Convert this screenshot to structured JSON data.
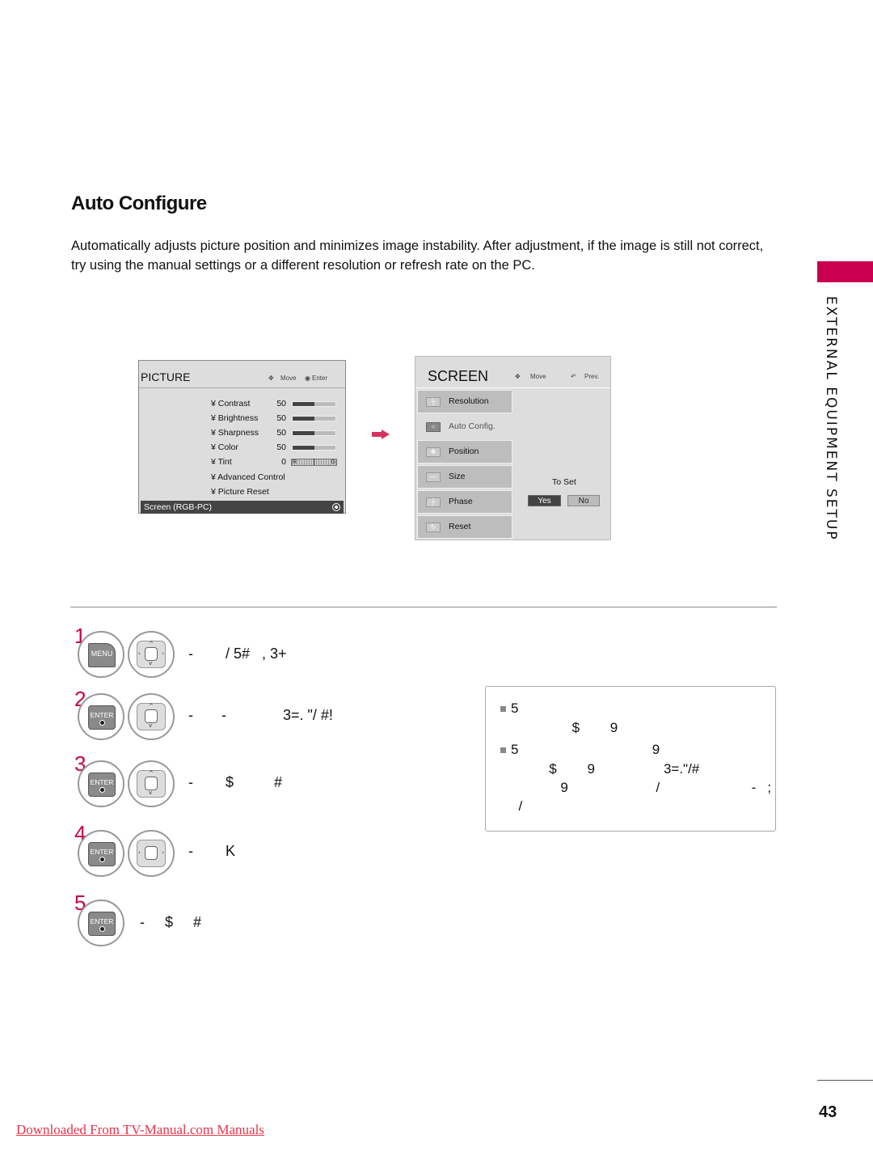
{
  "heading": "Auto Configure",
  "intro": "Automatically adjusts picture position and minimizes image instability. After adjustment, if the image is still not correct, try using the manual settings or a different resolution or refresh rate on the PC.",
  "side": {
    "label": "EXTERNAL EQUIPMENT SETUP",
    "accent_color": "#c8004f"
  },
  "picture_menu": {
    "title": "PICTURE",
    "hint_move": "Move",
    "hint_enter": "Enter",
    "items": [
      {
        "label": "¥ Contrast",
        "value": "50",
        "level_percent": 50
      },
      {
        "label": "¥ Brightness",
        "value": "50",
        "level_percent": 50
      },
      {
        "label": "¥ Sharpness",
        "value": "50",
        "level_percent": 50
      },
      {
        "label": "¥ Color",
        "value": "50",
        "level_percent": 50
      },
      {
        "label": "¥ Tint",
        "value": "0",
        "tint_left": "R",
        "tint_right": "G"
      },
      {
        "label": "¥ Advanced Control"
      },
      {
        "label": "¥ Picture Reset"
      }
    ],
    "selected_item": "Screen (RGB-PC)"
  },
  "screen_menu": {
    "title": "SCREEN",
    "hint_move": "Move",
    "hint_prev": "Prev.",
    "items": [
      {
        "label": "Resolution",
        "icon": "resolution-icon"
      },
      {
        "label": "Auto Config.",
        "icon": "auto-config-icon",
        "active": true
      },
      {
        "label": "Position",
        "icon": "position-icon"
      },
      {
        "label": "Size",
        "icon": "size-icon"
      },
      {
        "label": "Phase",
        "icon": "phase-icon"
      },
      {
        "label": "Reset",
        "icon": "reset-icon"
      }
    ],
    "prompt": "To Set",
    "yes_label": "Yes",
    "no_label": "No",
    "selected": "Yes"
  },
  "steps": [
    {
      "number": "1",
      "keys": [
        "MENU",
        "dpad-4way"
      ],
      "text": "-        / 5#   , 3+"
    },
    {
      "number": "2",
      "keys": [
        "ENTER",
        "dpad-updown"
      ],
      "text": "-       -              3=. \"/ #!"
    },
    {
      "number": "3",
      "keys": [
        "ENTER",
        "dpad-updown"
      ],
      "text": "-        $          #"
    },
    {
      "number": "4",
      "keys": [
        "ENTER",
        "dpad-leftright"
      ],
      "text": "-        K"
    },
    {
      "number": "5",
      "keys": [
        "ENTER"
      ],
      "text": "-     $     #"
    }
  ],
  "key_labels": {
    "menu": "MENU",
    "enter": "ENTER"
  },
  "notes": [
    {
      "lines": [
        "5",
        "                $        9"
      ]
    },
    {
      "lines": [
        "5                                   9",
        "          $        9                  3=.\"/#",
        "             9                       /                        -   ;",
        "  /"
      ]
    }
  ],
  "footer": {
    "page_number": "43",
    "link_text": "Downloaded From TV-Manual.com Manuals",
    "link_color": "#e8334a"
  }
}
